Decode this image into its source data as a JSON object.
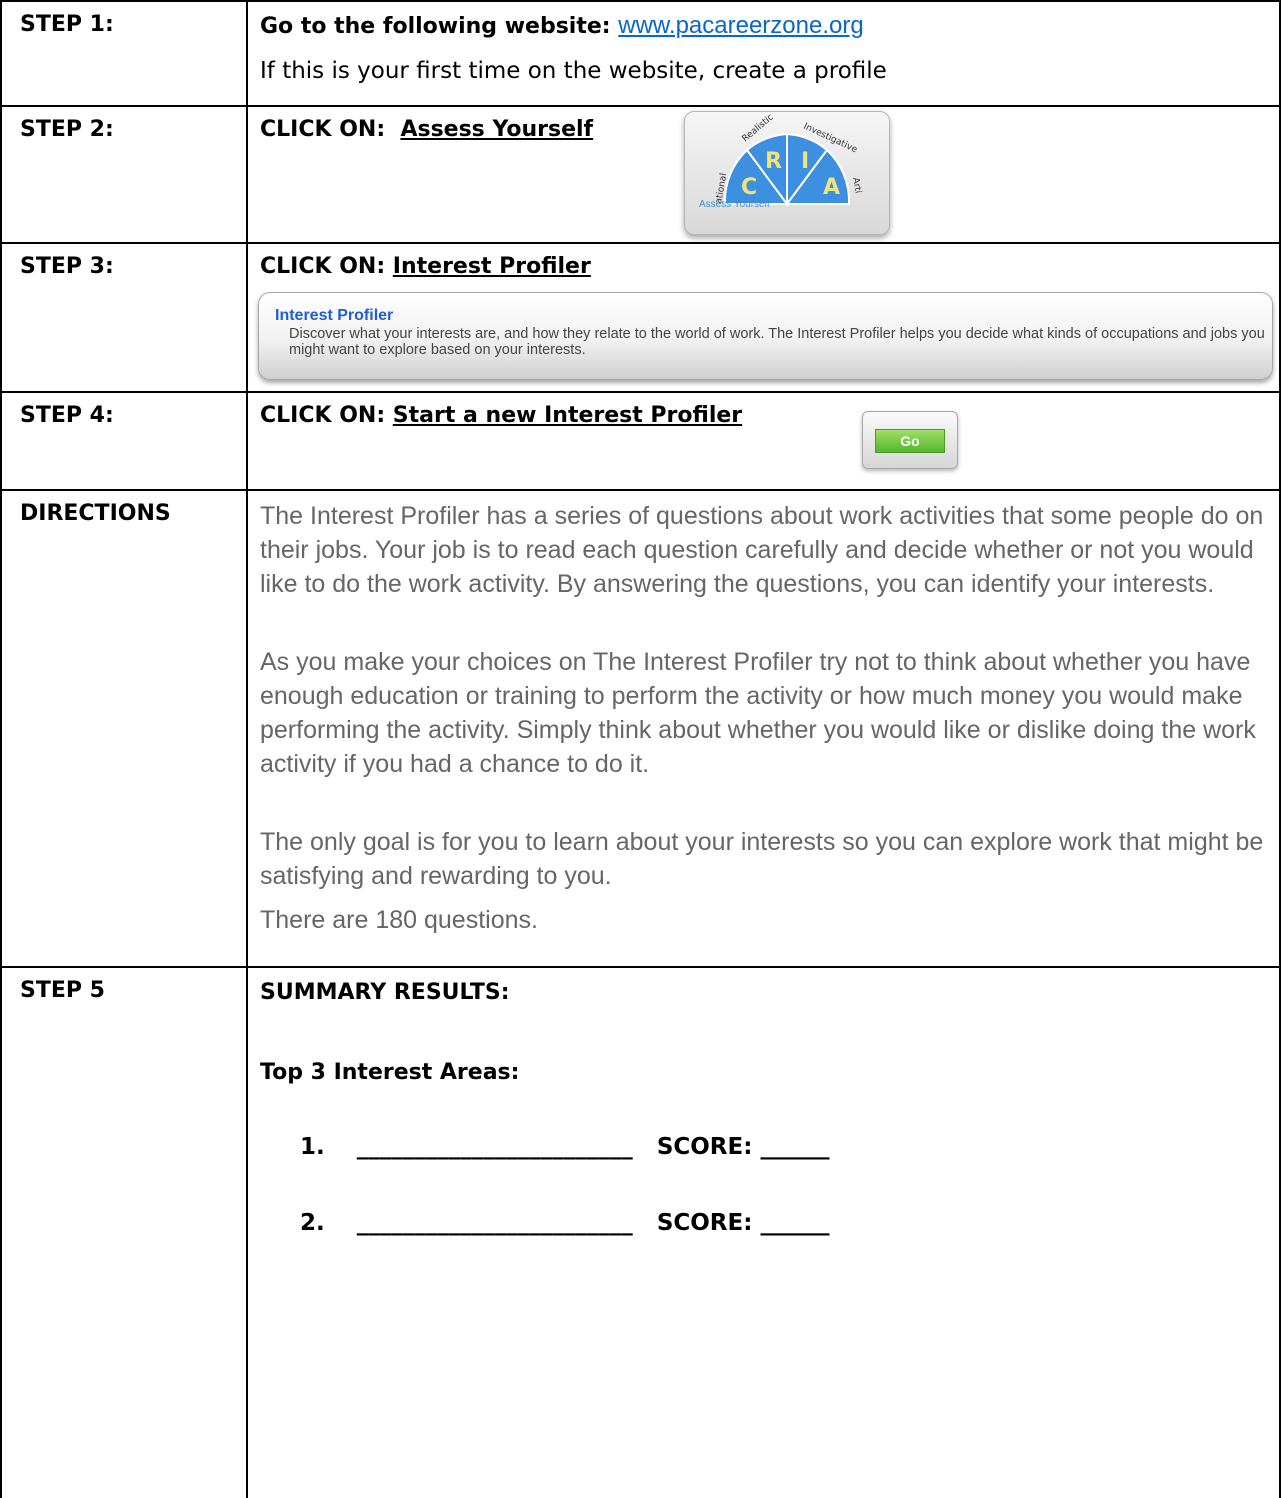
{
  "rows": {
    "step1": {
      "label": "STEP 1:",
      "prefix": "Go to the following website:",
      "link": "www.pacareerzone.org",
      "note": "If this is your first time on the website, create a profile"
    },
    "step2": {
      "label": "STEP 2:",
      "prefix": "CLICK ON:",
      "target": "Assess Yourself",
      "image": {
        "letters": [
          "C",
          "R",
          "I",
          "A"
        ],
        "words": [
          "Realistic",
          "Investigative",
          "ational",
          "Arti"
        ],
        "caption": "Assess Yourself"
      }
    },
    "step3": {
      "label": "STEP 3:",
      "prefix": "CLICK ON:",
      "target": "Interest Profiler",
      "banner_title": "Interest Profiler",
      "banner_text": "Discover what your interests are, and how they relate to the world of work. The Interest Profiler helps you decide what kinds of occupations and jobs you might want to explore based on your interests."
    },
    "step4": {
      "label": "STEP 4:",
      "prefix": "CLICK ON:",
      "target": "Start a new Interest Profiler",
      "go_label": "Go"
    },
    "directions": {
      "label": "DIRECTIONS",
      "p1": "The Interest Profiler has a series of questions about work activities that some people do on their jobs. Your job is to read each question carefully and decide whether or not you would like to do the work activity. By answering the questions, you can identify your interests.",
      "p2": "As you make your choices on The Interest Profiler try not to think about whether you have enough education or training to perform the activity or how much money you would make performing the activity. Simply think about whether you would like or dislike doing the work activity if you had a chance to do it.",
      "p3": "The only goal is for you to learn about your interests so you can explore work that might be satisfying and rewarding to you.",
      "p4": "There are 180 questions."
    },
    "step5": {
      "label": "STEP 5",
      "heading": "SUMMARY RESULTS:",
      "subheading": "Top 3 Interest Areas:",
      "items": [
        {
          "num": "1.",
          "blank": "________________________",
          "score_label": "SCORE:",
          "score_blank": "______"
        },
        {
          "num": "2.",
          "blank": "________________________",
          "score_label": "SCORE:",
          "score_blank": "______"
        }
      ]
    }
  },
  "colors": {
    "link": "#0a66c8",
    "gray_text": "#666666",
    "banner_title": "#1f5fd3",
    "go_button": "#55b52c",
    "wheel_blue": "#3d8fe0"
  }
}
